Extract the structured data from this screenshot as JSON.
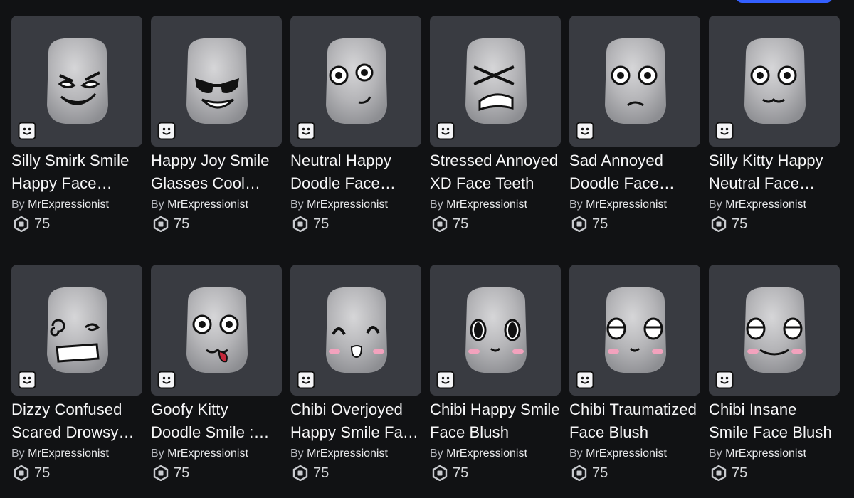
{
  "items": [
    {
      "name": "Silly Smirk Smile Happy Face Glasses Cool Face",
      "by": "By",
      "creator": "MrExpressionist",
      "price": "75",
      "face": "smirk"
    },
    {
      "name": "Happy Joy Smile Glasses Cool Face",
      "by": "By",
      "creator": "MrExpressionist",
      "price": "75",
      "face": "glasses"
    },
    {
      "name": "Neutral Happy Doodle Face Smile",
      "by": "By",
      "creator": "MrExpressionist",
      "price": "75",
      "face": "neutral"
    },
    {
      "name": "Stressed Annoyed XD Face Teeth",
      "by": "By",
      "creator": "MrExpressionist",
      "price": "75",
      "face": "stressed"
    },
    {
      "name": "Sad Annoyed Doodle Face Frown",
      "by": "By",
      "creator": "MrExpressionist",
      "price": "75",
      "face": "sad"
    },
    {
      "name": "Silly Kitty Happy Neutral Face Smile",
      "by": "By",
      "creator": "MrExpressionist",
      "price": "75",
      "face": "kitty"
    },
    {
      "name": "Dizzy Confused Scared Drowsy Face",
      "by": "By",
      "creator": "MrExpressionist",
      "price": "75",
      "face": "dizzy"
    },
    {
      "name": "Goofy Kitty Doodle Smile : Tongue Out",
      "by": "By",
      "creator": "MrExpressionist",
      "price": "75",
      "face": "goofy"
    },
    {
      "name": "Chibi Overjoyed Happy Smile Face Blush",
      "by": "By",
      "creator": "MrExpressionist",
      "price": "75",
      "face": "overjoyed"
    },
    {
      "name": "Chibi Happy Smile Face Blush",
      "by": "By",
      "creator": "MrExpressionist",
      "price": "75",
      "face": "chibi-happy"
    },
    {
      "name": "Chibi Traumatized Face Blush",
      "by": "By",
      "creator": "MrExpressionist",
      "price": "75",
      "face": "traumatized"
    },
    {
      "name": "Chibi Insane Smile Face Blush",
      "by": "By",
      "creator": "MrExpressionist",
      "price": "75",
      "face": "insane"
    }
  ]
}
